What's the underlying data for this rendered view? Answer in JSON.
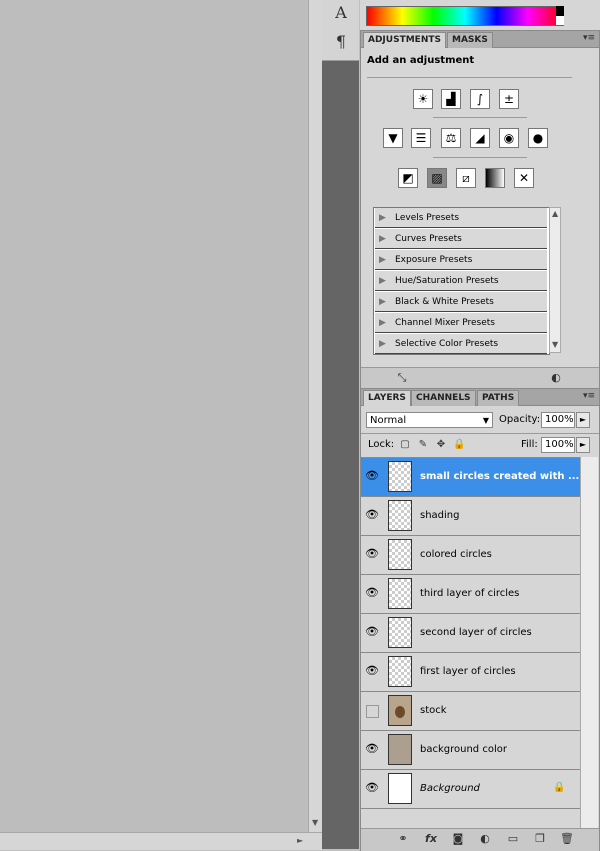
{
  "tools": {
    "text_tool": "A",
    "paragraph_tool": "¶"
  },
  "adjustments": {
    "tabs": [
      {
        "label": "ADJUSTMENTS"
      },
      {
        "label": "MASKS"
      }
    ],
    "title": "Add an adjustment",
    "presets": [
      {
        "label": "Levels Presets"
      },
      {
        "label": "Curves Presets"
      },
      {
        "label": "Exposure Presets"
      },
      {
        "label": "Hue/Saturation Presets"
      },
      {
        "label": "Black & White Presets"
      },
      {
        "label": "Channel Mixer Presets"
      },
      {
        "label": "Selective Color Presets"
      }
    ]
  },
  "layers": {
    "tabs": [
      {
        "label": "LAYERS"
      },
      {
        "label": "CHANNELS"
      },
      {
        "label": "PATHS"
      }
    ],
    "blend_mode": "Normal",
    "opacity_label": "Opacity:",
    "opacity_value": "100%",
    "lock_label": "Lock:",
    "fill_label": "Fill:",
    "fill_value": "100%",
    "items": [
      {
        "name": "small circles created with ..."
      },
      {
        "name": "shading"
      },
      {
        "name": "colored circles"
      },
      {
        "name": "third layer of circles"
      },
      {
        "name": "second layer of circles"
      },
      {
        "name": "first layer of circles"
      },
      {
        "name": "stock"
      },
      {
        "name": "background color"
      },
      {
        "name": "Background"
      }
    ]
  },
  "colors": {
    "selection": "#3c8fe9",
    "panel_bg": "#d6d6d6",
    "workspace_bg": "#bdbdbd"
  }
}
